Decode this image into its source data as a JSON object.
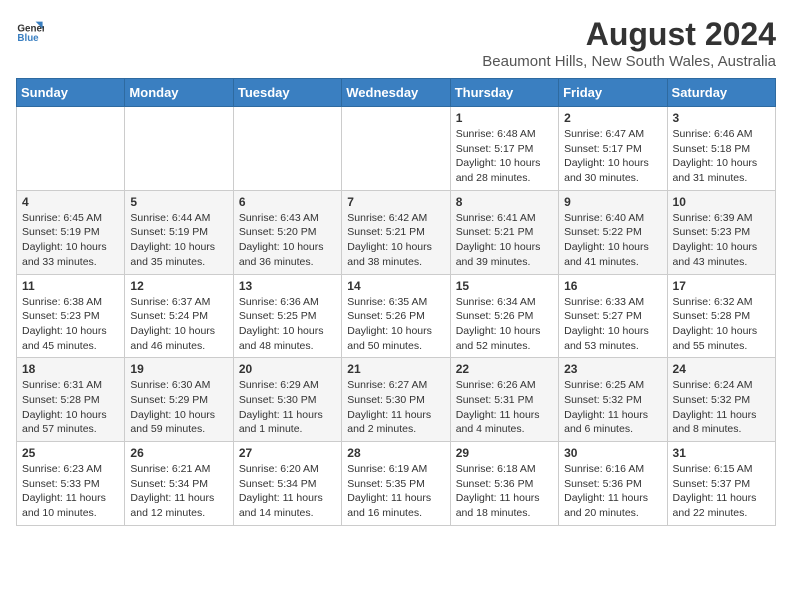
{
  "header": {
    "logo_line1": "General",
    "logo_line2": "Blue",
    "month_year": "August 2024",
    "location": "Beaumont Hills, New South Wales, Australia"
  },
  "weekdays": [
    "Sunday",
    "Monday",
    "Tuesday",
    "Wednesday",
    "Thursday",
    "Friday",
    "Saturday"
  ],
  "weeks": [
    [
      {
        "day": "",
        "info": ""
      },
      {
        "day": "",
        "info": ""
      },
      {
        "day": "",
        "info": ""
      },
      {
        "day": "",
        "info": ""
      },
      {
        "day": "1",
        "info": "Sunrise: 6:48 AM\nSunset: 5:17 PM\nDaylight: 10 hours\nand 28 minutes."
      },
      {
        "day": "2",
        "info": "Sunrise: 6:47 AM\nSunset: 5:17 PM\nDaylight: 10 hours\nand 30 minutes."
      },
      {
        "day": "3",
        "info": "Sunrise: 6:46 AM\nSunset: 5:18 PM\nDaylight: 10 hours\nand 31 minutes."
      }
    ],
    [
      {
        "day": "4",
        "info": "Sunrise: 6:45 AM\nSunset: 5:19 PM\nDaylight: 10 hours\nand 33 minutes."
      },
      {
        "day": "5",
        "info": "Sunrise: 6:44 AM\nSunset: 5:19 PM\nDaylight: 10 hours\nand 35 minutes."
      },
      {
        "day": "6",
        "info": "Sunrise: 6:43 AM\nSunset: 5:20 PM\nDaylight: 10 hours\nand 36 minutes."
      },
      {
        "day": "7",
        "info": "Sunrise: 6:42 AM\nSunset: 5:21 PM\nDaylight: 10 hours\nand 38 minutes."
      },
      {
        "day": "8",
        "info": "Sunrise: 6:41 AM\nSunset: 5:21 PM\nDaylight: 10 hours\nand 39 minutes."
      },
      {
        "day": "9",
        "info": "Sunrise: 6:40 AM\nSunset: 5:22 PM\nDaylight: 10 hours\nand 41 minutes."
      },
      {
        "day": "10",
        "info": "Sunrise: 6:39 AM\nSunset: 5:23 PM\nDaylight: 10 hours\nand 43 minutes."
      }
    ],
    [
      {
        "day": "11",
        "info": "Sunrise: 6:38 AM\nSunset: 5:23 PM\nDaylight: 10 hours\nand 45 minutes."
      },
      {
        "day": "12",
        "info": "Sunrise: 6:37 AM\nSunset: 5:24 PM\nDaylight: 10 hours\nand 46 minutes."
      },
      {
        "day": "13",
        "info": "Sunrise: 6:36 AM\nSunset: 5:25 PM\nDaylight: 10 hours\nand 48 minutes."
      },
      {
        "day": "14",
        "info": "Sunrise: 6:35 AM\nSunset: 5:26 PM\nDaylight: 10 hours\nand 50 minutes."
      },
      {
        "day": "15",
        "info": "Sunrise: 6:34 AM\nSunset: 5:26 PM\nDaylight: 10 hours\nand 52 minutes."
      },
      {
        "day": "16",
        "info": "Sunrise: 6:33 AM\nSunset: 5:27 PM\nDaylight: 10 hours\nand 53 minutes."
      },
      {
        "day": "17",
        "info": "Sunrise: 6:32 AM\nSunset: 5:28 PM\nDaylight: 10 hours\nand 55 minutes."
      }
    ],
    [
      {
        "day": "18",
        "info": "Sunrise: 6:31 AM\nSunset: 5:28 PM\nDaylight: 10 hours\nand 57 minutes."
      },
      {
        "day": "19",
        "info": "Sunrise: 6:30 AM\nSunset: 5:29 PM\nDaylight: 10 hours\nand 59 minutes."
      },
      {
        "day": "20",
        "info": "Sunrise: 6:29 AM\nSunset: 5:30 PM\nDaylight: 11 hours\nand 1 minute."
      },
      {
        "day": "21",
        "info": "Sunrise: 6:27 AM\nSunset: 5:30 PM\nDaylight: 11 hours\nand 2 minutes."
      },
      {
        "day": "22",
        "info": "Sunrise: 6:26 AM\nSunset: 5:31 PM\nDaylight: 11 hours\nand 4 minutes."
      },
      {
        "day": "23",
        "info": "Sunrise: 6:25 AM\nSunset: 5:32 PM\nDaylight: 11 hours\nand 6 minutes."
      },
      {
        "day": "24",
        "info": "Sunrise: 6:24 AM\nSunset: 5:32 PM\nDaylight: 11 hours\nand 8 minutes."
      }
    ],
    [
      {
        "day": "25",
        "info": "Sunrise: 6:23 AM\nSunset: 5:33 PM\nDaylight: 11 hours\nand 10 minutes."
      },
      {
        "day": "26",
        "info": "Sunrise: 6:21 AM\nSunset: 5:34 PM\nDaylight: 11 hours\nand 12 minutes."
      },
      {
        "day": "27",
        "info": "Sunrise: 6:20 AM\nSunset: 5:34 PM\nDaylight: 11 hours\nand 14 minutes."
      },
      {
        "day": "28",
        "info": "Sunrise: 6:19 AM\nSunset: 5:35 PM\nDaylight: 11 hours\nand 16 minutes."
      },
      {
        "day": "29",
        "info": "Sunrise: 6:18 AM\nSunset: 5:36 PM\nDaylight: 11 hours\nand 18 minutes."
      },
      {
        "day": "30",
        "info": "Sunrise: 6:16 AM\nSunset: 5:36 PM\nDaylight: 11 hours\nand 20 minutes."
      },
      {
        "day": "31",
        "info": "Sunrise: 6:15 AM\nSunset: 5:37 PM\nDaylight: 11 hours\nand 22 minutes."
      }
    ]
  ]
}
